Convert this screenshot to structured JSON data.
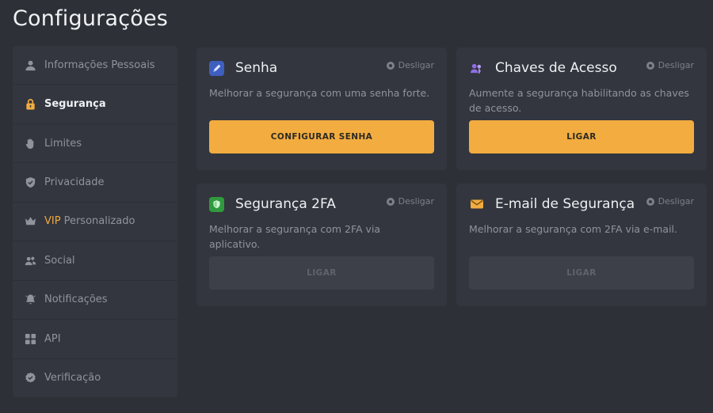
{
  "page": {
    "title": "Configurações"
  },
  "colors": {
    "accent": "#f2ac40",
    "background": "#2d3037",
    "panel": "#33363e"
  },
  "sidebar": {
    "items": [
      {
        "label": "Informações Pessoais",
        "icon": "user-icon",
        "active": false
      },
      {
        "label": "Segurança",
        "icon": "lock-icon",
        "active": true
      },
      {
        "label": "Limites",
        "icon": "hand-icon",
        "active": false
      },
      {
        "label": "Privacidade",
        "icon": "shield-icon",
        "active": false
      },
      {
        "vip": "VIP",
        "label": "Personalizado",
        "icon": "crown-icon",
        "active": false
      },
      {
        "label": "Social",
        "icon": "users-icon",
        "active": false
      },
      {
        "label": "Notificações",
        "icon": "bell-icon",
        "active": false
      },
      {
        "label": "API",
        "icon": "grid-icon",
        "active": false
      },
      {
        "label": "Verificação",
        "icon": "badge-check-icon",
        "active": false
      }
    ]
  },
  "cards": {
    "senha": {
      "title": "Senha",
      "icon": "pen-icon",
      "disable_label": "Desligar",
      "description": "Melhorar a segurança com uma senha forte.",
      "button": "CONFIGURAR SENHA",
      "button_enabled": true
    },
    "chaves": {
      "title": "Chaves de Acesso",
      "icon": "people-key-icon",
      "disable_label": "Desligar",
      "description": "Aumente a segurança habilitando as chaves de acesso.",
      "button": "LIGAR",
      "button_enabled": true
    },
    "twofa": {
      "title": "Segurança 2FA",
      "icon": "shield-2fa-icon",
      "disable_label": "Desligar",
      "description": "Melhorar a segurança com 2FA via aplicativo.",
      "button": "LIGAR",
      "button_enabled": false
    },
    "email": {
      "title": "E-mail de Segurança",
      "icon": "envelope-icon",
      "disable_label": "Desligar",
      "description": "Melhorar a segurança com 2FA via e-mail.",
      "button": "LIGAR",
      "button_enabled": false
    }
  }
}
